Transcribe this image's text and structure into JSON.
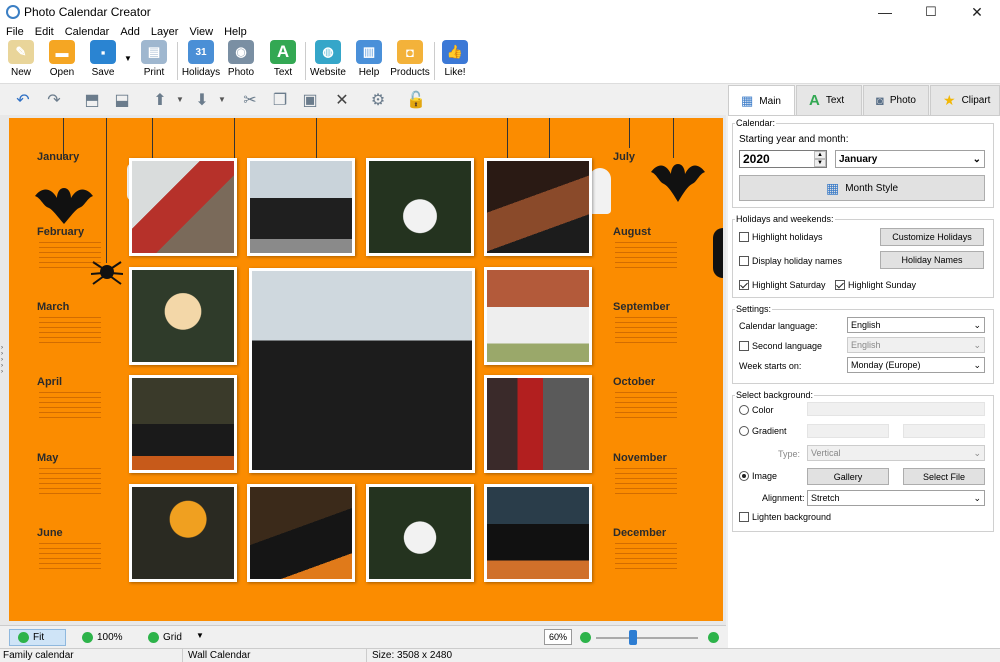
{
  "window": {
    "title": "Photo Calendar Creator",
    "minimize": "—",
    "maximize": "☐",
    "close": "✕"
  },
  "menu": [
    "File",
    "Edit",
    "Calendar",
    "Add",
    "Layer",
    "View",
    "Help"
  ],
  "toolbar": [
    {
      "label": "New",
      "icon": "new-document-icon",
      "color": "#e9d59a"
    },
    {
      "label": "Open",
      "icon": "folder-icon",
      "color": "#f5a623"
    },
    {
      "label": "Save",
      "icon": "floppy-disk-icon",
      "color": "#2a84d2"
    },
    {
      "label": "Print",
      "icon": "printer-icon",
      "color": "#9fb7cf"
    },
    {
      "label": "Holidays",
      "icon": "calendar-icon",
      "color": "#4a8fd6"
    },
    {
      "label": "Photo",
      "icon": "camera-icon",
      "color": "#7a8fa3"
    },
    {
      "label": "Text",
      "icon": "text-a-icon",
      "color": "#33a853"
    },
    {
      "label": "Website",
      "icon": "globe-icon",
      "color": "#35a6c9"
    },
    {
      "label": "Help",
      "icon": "book-icon",
      "color": "#4a90d9"
    },
    {
      "label": "Products",
      "icon": "box-icon",
      "color": "#f3b23a"
    },
    {
      "label": "Like!",
      "icon": "thumbs-up-icon",
      "color": "#3b78d6"
    }
  ],
  "toolbar2": [
    "undo-icon",
    "redo-icon",
    "bring-forward-icon",
    "send-backward-icon",
    "align-up-icon",
    "align-down-icon",
    "cut-icon",
    "copy-icon",
    "paste-icon",
    "delete-icon",
    "settings-icon",
    "lock-icon"
  ],
  "calendar": {
    "months_left": [
      "January",
      "February",
      "March",
      "April",
      "May",
      "June"
    ],
    "months_right": [
      "July",
      "August",
      "September",
      "October",
      "November",
      "December"
    ]
  },
  "zoombar": {
    "fit": "Fit",
    "hundred": "100%",
    "grid": "Grid",
    "zoom": "60%",
    "zoom_level": 0.6
  },
  "statusbar": {
    "item1": "Family calendar",
    "item2": "Wall Calendar",
    "item3": "Size: 3508 x 2480"
  },
  "panel": {
    "tabs": [
      {
        "label": "Main",
        "icon": "calendar-tab-icon"
      },
      {
        "label": "Text",
        "icon": "text-tab-icon"
      },
      {
        "label": "Photo",
        "icon": "photo-tab-icon"
      },
      {
        "label": "Clipart",
        "icon": "star-icon"
      }
    ],
    "calendar_group": "Calendar:",
    "start_label": "Starting year and month:",
    "year": "2020",
    "month": "January",
    "month_style": "Month Style",
    "holidays_group": "Holidays and weekends:",
    "highlight_holidays": "Highlight holidays",
    "customize_holidays": "Customize Holidays",
    "display_names": "Display holiday names",
    "holiday_names": "Holiday Names",
    "highlight_saturday": "Highlight Saturday",
    "highlight_sunday": "Highlight Sunday",
    "settings_group": "Settings:",
    "calendar_language_label": "Calendar language:",
    "calendar_language": "English",
    "second_language_label": "Second language",
    "second_language": "English",
    "week_starts_label": "Week starts on:",
    "week_starts": "Monday (Europe)",
    "background_group": "Select background:",
    "color": "Color",
    "gradient": "Gradient",
    "type_label": "Type:",
    "type_value": "Vertical",
    "image": "Image",
    "gallery": "Gallery",
    "select_file": "Select File",
    "alignment_label": "Alignment:",
    "alignment": "Stretch",
    "lighten": "Lighten background"
  }
}
